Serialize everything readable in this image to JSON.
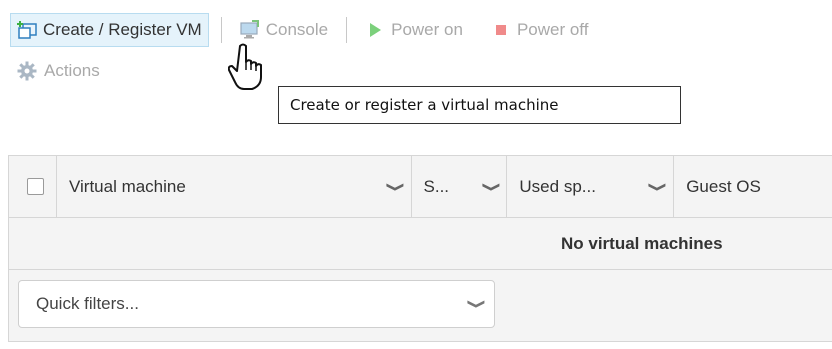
{
  "toolbar": {
    "create_register_vm": "Create / Register VM",
    "console": "Console",
    "power_on": "Power on",
    "power_off": "Power off",
    "actions": "Actions"
  },
  "tooltip": {
    "text": "Create or register a virtual machine"
  },
  "table": {
    "columns": [
      {
        "label": "Virtual machine"
      },
      {
        "label": "S..."
      },
      {
        "label": "Used sp..."
      },
      {
        "label": "Guest OS"
      }
    ],
    "empty_message": "No virtual machines"
  },
  "quick_filters": {
    "placeholder": "Quick filters..."
  },
  "colors": {
    "hover_bg": "#e5f3fb",
    "power_on": "#3cb043",
    "power_off": "#e35b5b",
    "disabled_text": "#a9a9a9"
  }
}
